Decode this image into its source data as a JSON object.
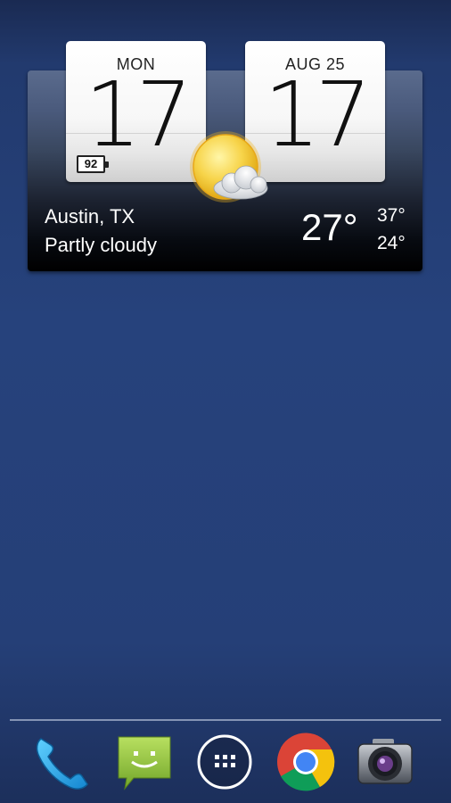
{
  "clock": {
    "day": "MON",
    "hour": "17",
    "date": "AUG 25",
    "minute": "17",
    "battery": "92"
  },
  "weather": {
    "city": "Austin, TX",
    "condition": "Partly cloudy",
    "current_temp": "27°",
    "high": "37°",
    "low": "24°",
    "icon": "partly-cloudy-icon"
  },
  "dock": {
    "items": [
      {
        "name": "Phone",
        "icon": "phone-icon"
      },
      {
        "name": "Messaging",
        "icon": "messaging-icon"
      },
      {
        "name": "Apps",
        "icon": "apps-grid-icon"
      },
      {
        "name": "Chrome",
        "icon": "chrome-icon"
      },
      {
        "name": "Camera",
        "icon": "camera-icon"
      }
    ]
  },
  "colors": {
    "wallpaper": "#26427c",
    "text": "#ffffff"
  }
}
